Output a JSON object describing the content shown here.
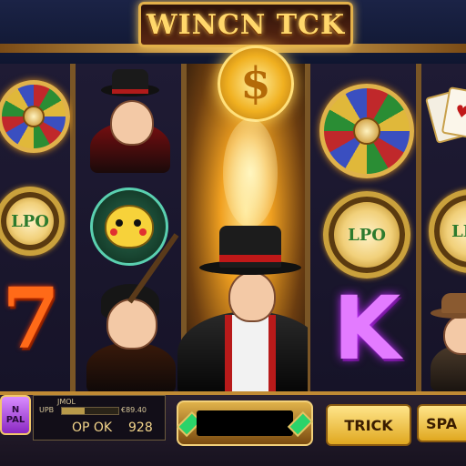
{
  "title": "WINCN TCK",
  "panel": {
    "left_button_line1": "N",
    "left_button_line2": "PAL",
    "info_label_1": "JMOL",
    "info_label_2": "UPB",
    "info_label_3": "€89.40",
    "info_value_left": "OP OK",
    "info_value_right": "928",
    "trick_label": "TRICK",
    "spin_label": "SPA"
  },
  "symbols": {
    "wheel_text": "LPO",
    "seven": "7",
    "king": "K",
    "coin_glyph": "$"
  },
  "colors": {
    "gold": "#e2b04a",
    "purple": "#c02cff",
    "orange": "#ff6a18"
  }
}
